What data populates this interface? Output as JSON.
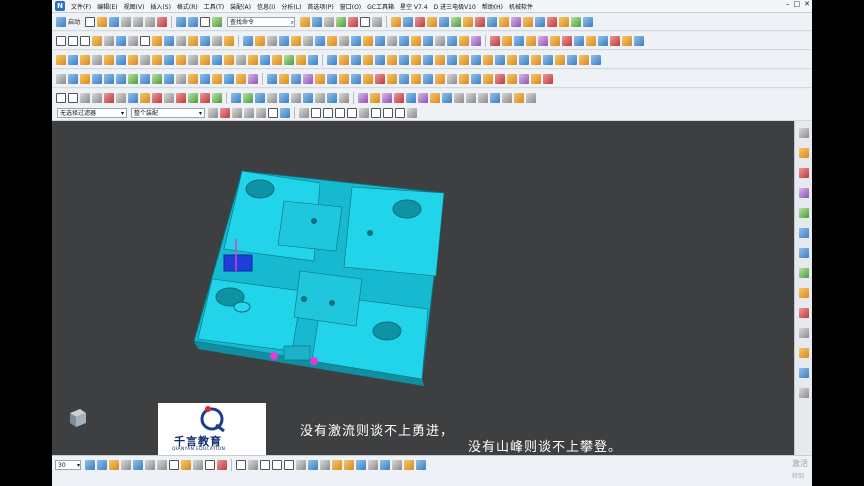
{
  "menubar": {
    "items": [
      "文件(F)",
      "编辑(E)",
      "视图(V)",
      "插入(S)",
      "格式(R)",
      "工具(T)",
      "装配(A)",
      "信息(I)",
      "分析(L)",
      "首选项(P)",
      "窗口(O)",
      "GC工具箱",
      "星空 V7.4",
      "D 进三电极V10",
      "帮助(H)",
      "机械软件"
    ],
    "controls": [
      "–",
      "□",
      "✕"
    ]
  },
  "toolbar": {
    "start_label": "启动",
    "search_placeholder": "查找命令",
    "search_icon": "search-icon"
  },
  "selection_bar": {
    "filter": "无选择过滤器",
    "scope": "整个装配"
  },
  "statusbar": {
    "zoom": "30"
  },
  "watermark": {
    "line1": "激活",
    "line2": "转到"
  },
  "overlay": {
    "logo_title": "千言教育",
    "logo_sub": "QIANYAN EDUCATION",
    "subtitle1": "没有激流则谈不上勇进，",
    "subtitle2": "没有山峰则谈不上攀登。"
  },
  "colors": {
    "model": "#1fd3e8",
    "background": "#3d3f41",
    "accent": "#2a6fc9"
  }
}
